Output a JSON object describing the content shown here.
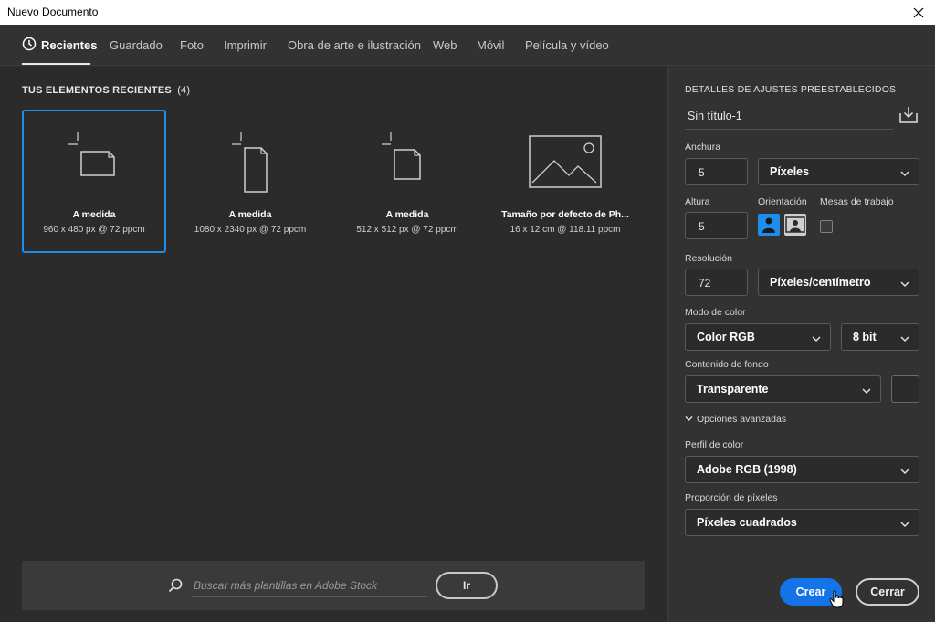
{
  "window": {
    "title": "Nuevo Documento",
    "close_icon": "close-icon"
  },
  "tabs": [
    {
      "label": "Recientes",
      "icon": "clock-icon",
      "active": true
    },
    {
      "label": "Guardado"
    },
    {
      "label": "Foto"
    },
    {
      "label": "Imprimir"
    },
    {
      "label": "Obra de arte e ilustración"
    },
    {
      "label": "Web"
    },
    {
      "label": "Móvil"
    },
    {
      "label": "Película y vídeo"
    }
  ],
  "recent": {
    "title": "TUS ELEMENTOS RECIENTES",
    "count": "(4)",
    "items": [
      {
        "name": "A medida",
        "dims": "960 x 480 px @ 72 ppcm",
        "icon": "landscape-document-icon",
        "selected": true
      },
      {
        "name": "A medida",
        "dims": "1080 x 2340 px @ 72 ppcm",
        "icon": "portrait-document-icon"
      },
      {
        "name": "A medida",
        "dims": "512 x 512 px @ 72 ppcm",
        "icon": "square-document-icon"
      },
      {
        "name": "Tamaño por defecto de Ph...",
        "dims": "16 x 12 cm @ 118.11 ppcm",
        "icon": "image-placeholder-icon"
      }
    ]
  },
  "search": {
    "placeholder": "Buscar más plantillas en Adobe Stock",
    "go_label": "Ir",
    "icon": "search-icon"
  },
  "details": {
    "header": "DETALLES DE AJUSTES PREESTABLECIDOS",
    "doc_name": "Sin título-1",
    "save_icon": "save-preset-icon",
    "width_label": "Anchura",
    "width_value": "5",
    "width_unit": "Píxeles",
    "height_label": "Altura",
    "height_value": "5",
    "orientation_label": "Orientación",
    "orientation": "portrait",
    "artboards_label": "Mesas de trabajo",
    "artboards_checked": false,
    "resolution_label": "Resolución",
    "resolution_value": "72",
    "resolution_unit": "Píxeles/centímetro",
    "color_mode_label": "Modo de color",
    "color_mode": "Color RGB",
    "bit_depth": "8 bit",
    "background_label": "Contenido de fondo",
    "background": "Transparente",
    "advanced_label": "Opciones avanzadas",
    "color_profile_label": "Perfil de color",
    "color_profile": "Adobe RGB (1998)",
    "pixel_ratio_label": "Proporción de píxeles",
    "pixel_ratio": "Píxeles cuadrados"
  },
  "actions": {
    "create_label": "Crear",
    "close_label": "Cerrar"
  },
  "colors": {
    "accent": "#1473e6",
    "selection": "#1e8ded",
    "panel": "#323232",
    "background": "#2b2b2b"
  }
}
